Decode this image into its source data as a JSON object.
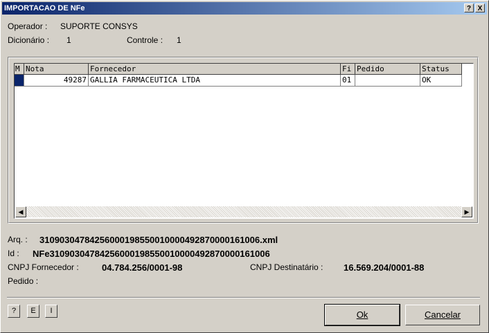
{
  "window": {
    "title": "IMPORTACAO DE NFe",
    "help_btn": "?",
    "close_btn": "X"
  },
  "header": {
    "operador_label": "Operador :",
    "operador_value": "SUPORTE CONSYS",
    "dicionario_label": "Dicionário :",
    "dicionario_value": "1",
    "controle_label": "Controle :",
    "controle_value": "1"
  },
  "grid": {
    "columns": [
      "M",
      "Nota",
      "Fornecedor",
      "Fi",
      "Pedido",
      "Status"
    ],
    "rows": [
      {
        "m": "",
        "nota": "49287",
        "fornecedor": "GALLIA FARMACEUTICA LTDA",
        "fi": "01",
        "pedido": "",
        "status": "OK"
      }
    ]
  },
  "details": {
    "arq_label": "Arq. :",
    "arq_value": "31090304784256000198550010000492870000161006.xml",
    "id_label": "Id :",
    "id_value": "NFe31090304784256000198550010000492870000161006",
    "cnpj_forn_label": "CNPJ Fornecedor :",
    "cnpj_forn_value": "04.784.256/0001-98",
    "cnpj_dest_label": "CNPJ Destinatário :",
    "cnpj_dest_value": "16.569.204/0001-88",
    "pedido_label": "Pedido :",
    "pedido_value": ""
  },
  "footer": {
    "small_buttons": [
      "?",
      "E",
      "I"
    ],
    "ok_label": "Ok",
    "cancel_label": "Cancelar"
  },
  "colors": {
    "titlebar_start": "#0a246a",
    "titlebar_end": "#a6caf0",
    "face": "#d4d0c8",
    "selection": "#0a246a"
  }
}
